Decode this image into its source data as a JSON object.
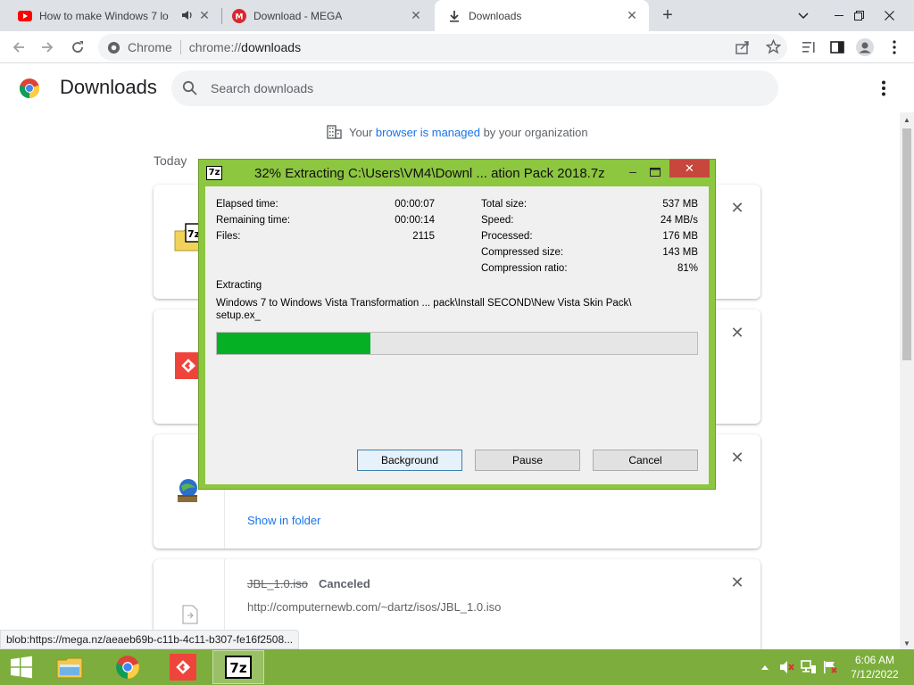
{
  "browser": {
    "tabs": [
      {
        "title": "How to make Windows 7 lo",
        "favicon": "youtube-icon"
      },
      {
        "title": "Download - MEGA",
        "favicon": "mega-icon"
      },
      {
        "title": "Downloads",
        "favicon": "download-icon"
      }
    ],
    "omnibox": {
      "label": "Chrome",
      "url_scheme": "chrome://",
      "url_host": "downloads"
    }
  },
  "downloads": {
    "title": "Downloads",
    "search_placeholder": "Search downloads",
    "managed": {
      "prefix": "Your ",
      "link": "browser is managed",
      "suffix": " by your organization"
    },
    "section_today": "Today",
    "items": [
      {
        "icon": "7z-archive-icon"
      },
      {
        "icon": "anydesk-icon"
      },
      {
        "icon": "installer-icon",
        "action": "Show in folder"
      },
      {
        "filename": "JBL_1.0.iso",
        "status": "Canceled",
        "url": "http://computernewb.com/~dartz/isos/JBL_1.0.iso",
        "icon": "file-icon"
      }
    ],
    "status_bar_url": "blob:https://mega.nz/aeaeb69b-c11b-4c11-b307-fe16f2508..."
  },
  "dialog": {
    "icon_text": "7z",
    "title": "32% Extracting C:\\Users\\VM4\\Downl ... ation Pack 2018.7z",
    "left_stats": [
      {
        "label": "Elapsed time:",
        "value": "00:00:07"
      },
      {
        "label": "Remaining time:",
        "value": "00:00:14"
      },
      {
        "label": "Files:",
        "value": "2115"
      }
    ],
    "right_stats": [
      {
        "label": "Total size:",
        "value": "537 MB"
      },
      {
        "label": "Speed:",
        "value": "24 MB/s"
      },
      {
        "label": "Processed:",
        "value": "176 MB"
      },
      {
        "label": "Compressed size:",
        "value": "143 MB"
      },
      {
        "label": "Compression ratio:",
        "value": "81%"
      }
    ],
    "operation": "Extracting",
    "current_file_line1": "Windows 7 to Windows Vista Transformation ... pack\\Install SECOND\\New Vista Skin Pack\\",
    "current_file_line2": "setup.ex_",
    "progress_percent": 32,
    "buttons": {
      "background": "Background",
      "pause": "Pause",
      "cancel": "Cancel"
    }
  },
  "taskbar": {
    "items": [
      "file-explorer-icon",
      "chrome-icon",
      "anydesk-icon",
      "7zip-icon"
    ],
    "clock_time": "6:06 AM",
    "clock_date": "7/12/2022"
  },
  "colors": {
    "taskbar": "#7dae3d",
    "dialog_frame": "#8dc63f",
    "progress_fill": "#06b025",
    "link": "#1a73e8"
  }
}
